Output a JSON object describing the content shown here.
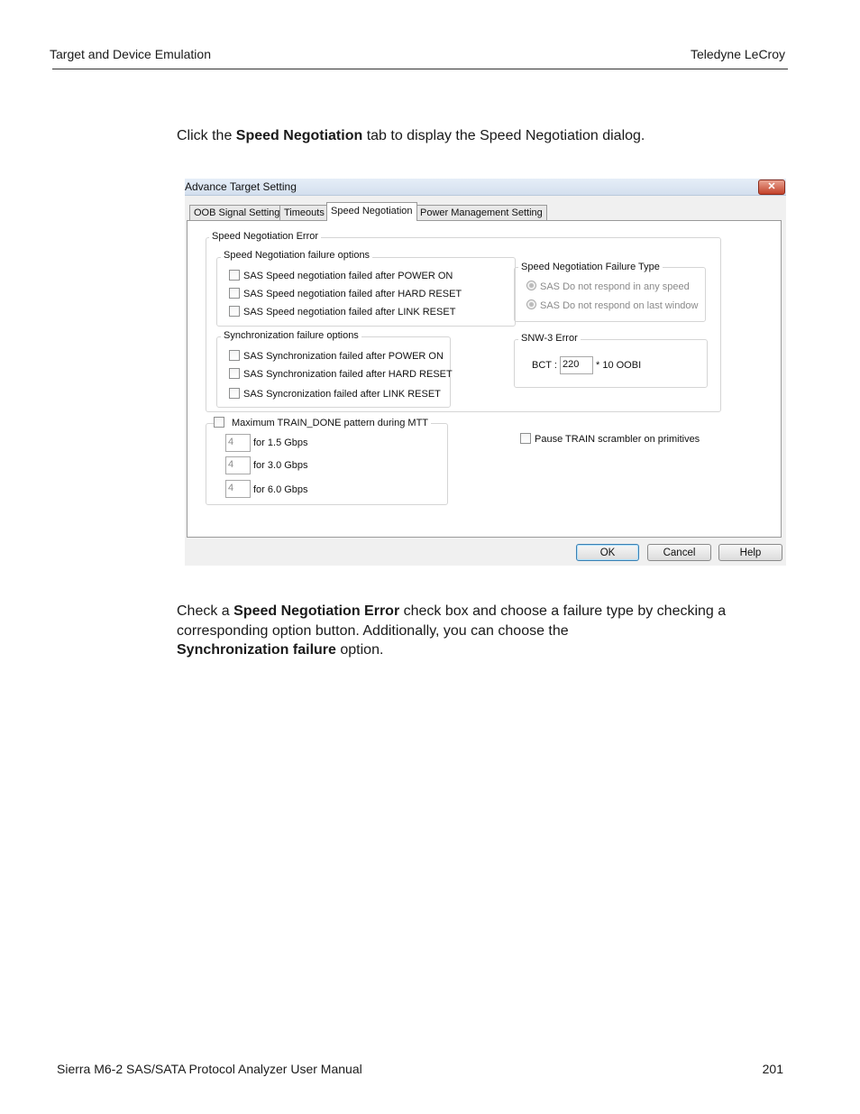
{
  "header": {
    "left": "Target and Device Emulation",
    "right": "Teledyne LeCroy"
  },
  "intro": {
    "pre": "Click the ",
    "bold": "Speed Negotiation",
    "post": " tab to display the Speed Negotiation dialog."
  },
  "dialog": {
    "title": "Advance Target Setting",
    "close_glyph": "✕",
    "tabs": [
      "OOB Signal Setting",
      "Timeouts",
      "Speed Negotiation",
      "Power Management Setting"
    ],
    "active_tab": "Speed Negotiation",
    "sn_error_title": "Speed Negotiation Error",
    "failure_options": {
      "title": "Speed Negotiation failure options",
      "items": [
        "SAS Speed negotiation failed after POWER ON",
        "SAS Speed negotiation failed after HARD RESET",
        "SAS Speed negotiation failed after LINK RESET"
      ]
    },
    "failure_type": {
      "title": "Speed Negotiation Failure Type",
      "items": [
        "SAS Do not respond in any speed",
        "SAS Do not respond on last window"
      ]
    },
    "sync_options": {
      "title": "Synchronization failure options",
      "items": [
        "SAS Synchronization failed after POWER ON",
        "SAS Synchronization failed after HARD RESET",
        "SAS Syncronization failed after LINK RESET"
      ]
    },
    "snw3": {
      "title": "SNW-3 Error",
      "label": "BCT :",
      "value": "220",
      "suffix": "* 10  OOBI"
    },
    "train_done": {
      "title": "Maximum TRAIN_DONE pattern during MTT",
      "rows": [
        {
          "value": "4",
          "label": "for 1.5 Gbps"
        },
        {
          "value": "4",
          "label": "for 3.0 Gbps"
        },
        {
          "value": "4",
          "label": "for 6.0 Gbps"
        }
      ]
    },
    "pause_label": "Pause TRAIN scrambler on primitives",
    "buttons": {
      "ok": "OK",
      "cancel": "Cancel",
      "help": "Help"
    }
  },
  "body2": {
    "s1": "Check a ",
    "b1": "Speed Negotiation Error",
    "s2": " check box and choose a failure type by checking a corresponding option button. Additionally, you can choose the",
    "b2": "Synchronization failure",
    "s3": " option."
  },
  "footer": {
    "left": "Sierra M6-2 SAS/SATA Protocol Analyzer User Manual",
    "right": "201"
  }
}
